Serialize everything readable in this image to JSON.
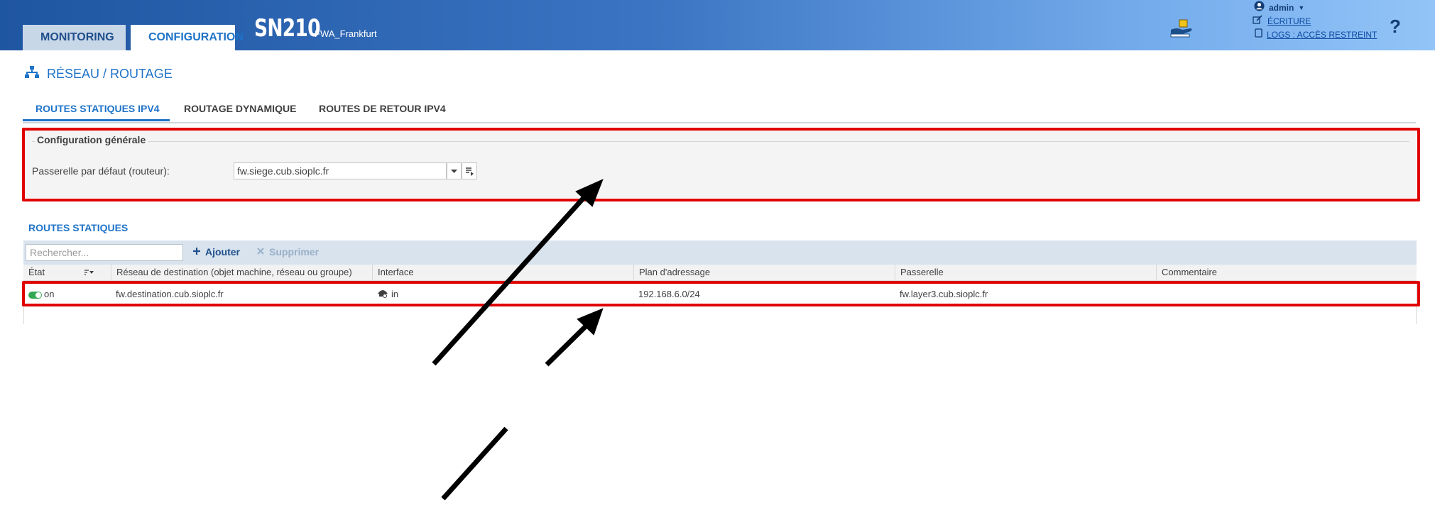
{
  "header": {
    "tabs": [
      {
        "label": "MONITORING"
      },
      {
        "label": "CONFIGURATION"
      }
    ],
    "model": "SN210",
    "firewall_name": "FWA_Frankfurt",
    "user": {
      "name": "admin",
      "write_label": "ÉCRITURE",
      "logs_label": "LOGS : ACCÈS RESTREINT"
    },
    "help_label": "?"
  },
  "breadcrumb": "RÉSEAU / ROUTAGE",
  "tabs": [
    {
      "label": "ROUTES STATIQUES IPV4",
      "active": true
    },
    {
      "label": "ROUTAGE DYNAMIQUE",
      "active": false
    },
    {
      "label": "ROUTES DE RETOUR IPV4",
      "active": false
    }
  ],
  "general_config": {
    "legend": "Configuration générale",
    "gateway_label": "Passerelle par défaut (routeur):",
    "gateway_value": "fw.siege.cub.sioplc.fr"
  },
  "static_routes": {
    "title": "ROUTES STATIQUES",
    "search_placeholder": "Rechercher...",
    "add_label": "Ajouter",
    "delete_label": "Supprimer",
    "columns": [
      "État",
      "Réseau de destination (objet machine, réseau ou groupe)",
      "Interface",
      "Plan d'adressage",
      "Passerelle",
      "Commentaire"
    ],
    "rows": [
      {
        "state": "on",
        "destination": "fw.destination.cub.sioplc.fr",
        "interface": "in",
        "address_plan": "192.168.6.0/24",
        "gateway": "fw.layer3.cub.sioplc.fr",
        "comment": ""
      }
    ]
  },
  "colors": {
    "accent": "#1e73c8",
    "highlight": "#e00000",
    "toggle_on": "#32a852"
  }
}
